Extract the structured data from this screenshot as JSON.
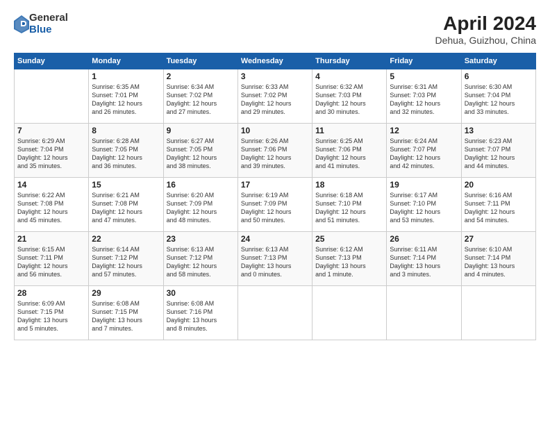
{
  "logo": {
    "general": "General",
    "blue": "Blue"
  },
  "title": "April 2024",
  "location": "Dehua, Guizhou, China",
  "days_of_week": [
    "Sunday",
    "Monday",
    "Tuesday",
    "Wednesday",
    "Thursday",
    "Friday",
    "Saturday"
  ],
  "weeks": [
    [
      {
        "day": "",
        "info": ""
      },
      {
        "day": "1",
        "info": "Sunrise: 6:35 AM\nSunset: 7:01 PM\nDaylight: 12 hours\nand 26 minutes."
      },
      {
        "day": "2",
        "info": "Sunrise: 6:34 AM\nSunset: 7:02 PM\nDaylight: 12 hours\nand 27 minutes."
      },
      {
        "day": "3",
        "info": "Sunrise: 6:33 AM\nSunset: 7:02 PM\nDaylight: 12 hours\nand 29 minutes."
      },
      {
        "day": "4",
        "info": "Sunrise: 6:32 AM\nSunset: 7:03 PM\nDaylight: 12 hours\nand 30 minutes."
      },
      {
        "day": "5",
        "info": "Sunrise: 6:31 AM\nSunset: 7:03 PM\nDaylight: 12 hours\nand 32 minutes."
      },
      {
        "day": "6",
        "info": "Sunrise: 6:30 AM\nSunset: 7:04 PM\nDaylight: 12 hours\nand 33 minutes."
      }
    ],
    [
      {
        "day": "7",
        "info": "Sunrise: 6:29 AM\nSunset: 7:04 PM\nDaylight: 12 hours\nand 35 minutes."
      },
      {
        "day": "8",
        "info": "Sunrise: 6:28 AM\nSunset: 7:05 PM\nDaylight: 12 hours\nand 36 minutes."
      },
      {
        "day": "9",
        "info": "Sunrise: 6:27 AM\nSunset: 7:05 PM\nDaylight: 12 hours\nand 38 minutes."
      },
      {
        "day": "10",
        "info": "Sunrise: 6:26 AM\nSunset: 7:06 PM\nDaylight: 12 hours\nand 39 minutes."
      },
      {
        "day": "11",
        "info": "Sunrise: 6:25 AM\nSunset: 7:06 PM\nDaylight: 12 hours\nand 41 minutes."
      },
      {
        "day": "12",
        "info": "Sunrise: 6:24 AM\nSunset: 7:07 PM\nDaylight: 12 hours\nand 42 minutes."
      },
      {
        "day": "13",
        "info": "Sunrise: 6:23 AM\nSunset: 7:07 PM\nDaylight: 12 hours\nand 44 minutes."
      }
    ],
    [
      {
        "day": "14",
        "info": "Sunrise: 6:22 AM\nSunset: 7:08 PM\nDaylight: 12 hours\nand 45 minutes."
      },
      {
        "day": "15",
        "info": "Sunrise: 6:21 AM\nSunset: 7:08 PM\nDaylight: 12 hours\nand 47 minutes."
      },
      {
        "day": "16",
        "info": "Sunrise: 6:20 AM\nSunset: 7:09 PM\nDaylight: 12 hours\nand 48 minutes."
      },
      {
        "day": "17",
        "info": "Sunrise: 6:19 AM\nSunset: 7:09 PM\nDaylight: 12 hours\nand 50 minutes."
      },
      {
        "day": "18",
        "info": "Sunrise: 6:18 AM\nSunset: 7:10 PM\nDaylight: 12 hours\nand 51 minutes."
      },
      {
        "day": "19",
        "info": "Sunrise: 6:17 AM\nSunset: 7:10 PM\nDaylight: 12 hours\nand 53 minutes."
      },
      {
        "day": "20",
        "info": "Sunrise: 6:16 AM\nSunset: 7:11 PM\nDaylight: 12 hours\nand 54 minutes."
      }
    ],
    [
      {
        "day": "21",
        "info": "Sunrise: 6:15 AM\nSunset: 7:11 PM\nDaylight: 12 hours\nand 56 minutes."
      },
      {
        "day": "22",
        "info": "Sunrise: 6:14 AM\nSunset: 7:12 PM\nDaylight: 12 hours\nand 57 minutes."
      },
      {
        "day": "23",
        "info": "Sunrise: 6:13 AM\nSunset: 7:12 PM\nDaylight: 12 hours\nand 58 minutes."
      },
      {
        "day": "24",
        "info": "Sunrise: 6:13 AM\nSunset: 7:13 PM\nDaylight: 13 hours\nand 0 minutes."
      },
      {
        "day": "25",
        "info": "Sunrise: 6:12 AM\nSunset: 7:13 PM\nDaylight: 13 hours\nand 1 minute."
      },
      {
        "day": "26",
        "info": "Sunrise: 6:11 AM\nSunset: 7:14 PM\nDaylight: 13 hours\nand 3 minutes."
      },
      {
        "day": "27",
        "info": "Sunrise: 6:10 AM\nSunset: 7:14 PM\nDaylight: 13 hours\nand 4 minutes."
      }
    ],
    [
      {
        "day": "28",
        "info": "Sunrise: 6:09 AM\nSunset: 7:15 PM\nDaylight: 13 hours\nand 5 minutes."
      },
      {
        "day": "29",
        "info": "Sunrise: 6:08 AM\nSunset: 7:15 PM\nDaylight: 13 hours\nand 7 minutes."
      },
      {
        "day": "30",
        "info": "Sunrise: 6:08 AM\nSunset: 7:16 PM\nDaylight: 13 hours\nand 8 minutes."
      },
      {
        "day": "",
        "info": ""
      },
      {
        "day": "",
        "info": ""
      },
      {
        "day": "",
        "info": ""
      },
      {
        "day": "",
        "info": ""
      }
    ]
  ]
}
